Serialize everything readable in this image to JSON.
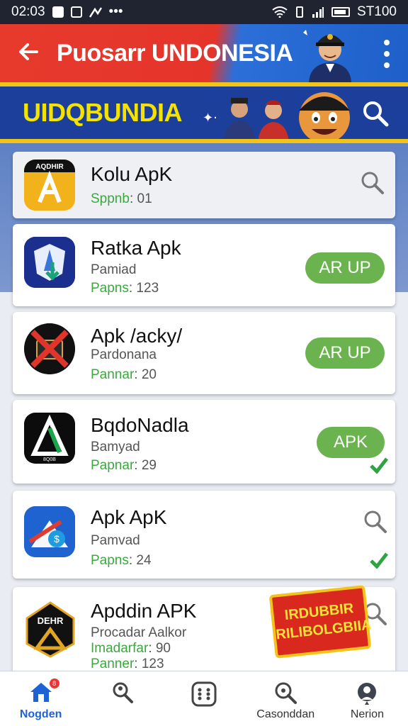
{
  "status_bar": {
    "time": "02:03",
    "right_text": "ST100"
  },
  "app_bar": {
    "title": "Puosarr UNDONESIA"
  },
  "banner": {
    "title": "UIDQBUNDIA"
  },
  "apps": [
    {
      "icon": "apk-logo-icon",
      "icon_text": "AQDHIR",
      "name": "Kolu ApK",
      "sub": "",
      "meta_key": "Sppnb",
      "meta_value": ": 01",
      "action": "search"
    },
    {
      "icon": "shield-download-icon",
      "name": "Ratka Apk",
      "sub": "Pamiad",
      "meta_key": "Papns",
      "meta_value": ": 123",
      "action": "button",
      "button_label": "AR UP"
    },
    {
      "icon": "blocked-app-icon",
      "name": "Apk /acky/",
      "sub": "Pardonana",
      "meta_key": "Pannar",
      "meta_value": ": 20",
      "action": "button",
      "button_label": "AR UP"
    },
    {
      "icon": "triangle-logo-icon",
      "icon_text": "8Q0B",
      "name": "BqdoNadla",
      "sub": "Bamyad",
      "meta_key": "Papnar",
      "meta_value": ": 29",
      "action": "button-check",
      "button_label": "APK"
    },
    {
      "icon": "arrow-shield-icon",
      "name": "Apk ApK",
      "sub": "Pamvad",
      "meta_key": "Papns",
      "meta_value": ": 24",
      "action": "search-check"
    },
    {
      "icon": "diamond-logo-icon",
      "icon_text": "DEHR",
      "name": "Apddin APK",
      "sub": "Procadar Aalkor",
      "meta_key": "Imadarfar",
      "meta_value": ": 90",
      "meta2_key": "Panner",
      "meta2_value": ": 123",
      "action": "search",
      "stamp_text": "IRDUBBIR RILIBOLGBIIA"
    }
  ],
  "bottom_nav": [
    {
      "label": "Nogden",
      "icon": "home-icon",
      "badge": "8"
    },
    {
      "label": "",
      "icon": "search-person-icon"
    },
    {
      "label": "",
      "icon": "apps-grid-icon"
    },
    {
      "label": "Casonddan",
      "icon": "search-icon"
    },
    {
      "label": "Nerion",
      "icon": "profile-icon"
    }
  ],
  "colors": {
    "accent_red": "#e73a2c",
    "accent_blue": "#1e5fc9",
    "banner_blue": "#1b3f9a",
    "banner_yellow": "#f4e300",
    "button_green": "#6ab34e",
    "meta_green": "#3aa83e"
  }
}
